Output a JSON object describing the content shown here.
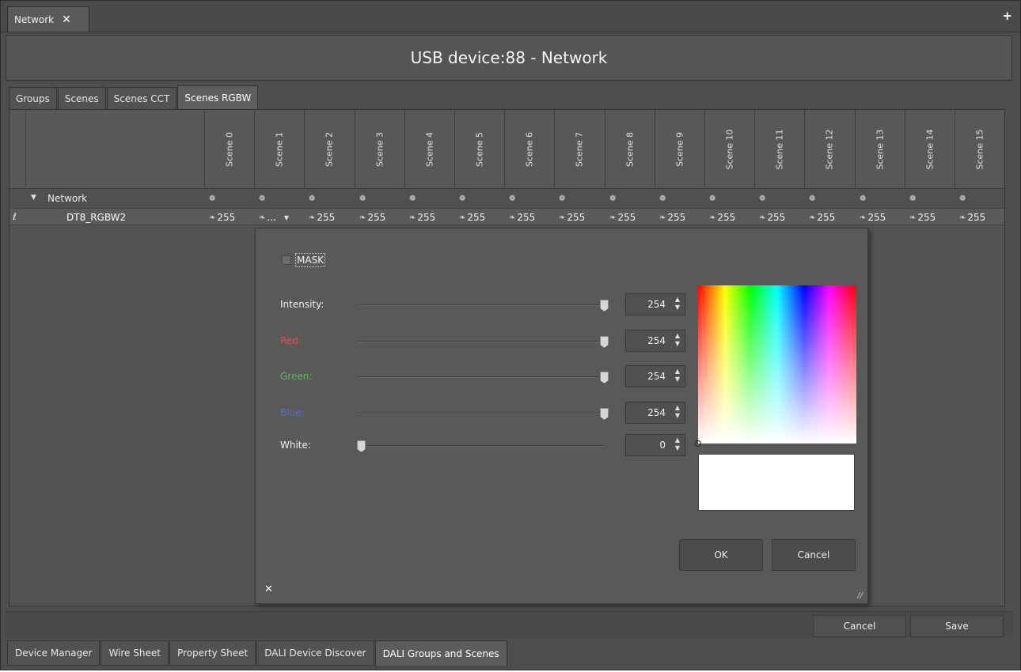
{
  "doc_tab": {
    "label": "Network",
    "close": "✕"
  },
  "plus": "+",
  "title": "USB device:88 - Network",
  "scene_tabs": [
    "Groups",
    "Scenes",
    "Scenes CCT",
    "Scenes RGBW"
  ],
  "grid": {
    "columns": [
      "Scene 0",
      "Scene 1",
      "Scene 2",
      "Scene 3",
      "Scene 4",
      "Scene 5",
      "Scene 6",
      "Scene 7",
      "Scene 8",
      "Scene 9",
      "Scene 10",
      "Scene 11",
      "Scene 12",
      "Scene 13",
      "Scene 14",
      "Scene 15"
    ],
    "group_row": {
      "expander": "▼",
      "label": "Network",
      "icon": "gear-icon",
      "glyph": "❁"
    },
    "device_row": {
      "label": "DT8_RGBW2",
      "edit_glyph": "ℓ",
      "leaf_glyph": "❧",
      "values": [
        "255",
        "...",
        "255",
        "255",
        "255",
        "255",
        "255",
        "255",
        "255",
        "255",
        "255",
        "255",
        "255",
        "255",
        "255",
        "255"
      ],
      "dropdown_glyph": "▼"
    }
  },
  "popup": {
    "mask_label": "MASK",
    "sliders": [
      {
        "label": "Intensity:",
        "value": "254",
        "color": "#f0f0f0",
        "level": 254
      },
      {
        "label": "Red:",
        "value": "254",
        "color": "#e05050",
        "level": 254
      },
      {
        "label": "Green:",
        "value": "254",
        "color": "#4fc24f",
        "level": 254
      },
      {
        "label": "Blue:",
        "value": "254",
        "color": "#4f6fe0",
        "level": 254
      },
      {
        "label": "White:",
        "value": "0",
        "color": "#f0f0f0",
        "level": 0
      }
    ],
    "spin_up": "▲",
    "spin_down": "▼",
    "ok": "OK",
    "cancel": "Cancel",
    "close": "✕",
    "grip": "//",
    "preview_color": "#ffffff"
  },
  "bottom_buttons": {
    "cancel": "Cancel",
    "save": "Save"
  },
  "bottom_tabs": [
    "Device Manager",
    "Wire Sheet",
    "Property Sheet",
    "DALI Device Discover",
    "DALI Groups and Scenes"
  ],
  "colors": {
    "background": "#4e4e4e",
    "panel": "#595959"
  }
}
